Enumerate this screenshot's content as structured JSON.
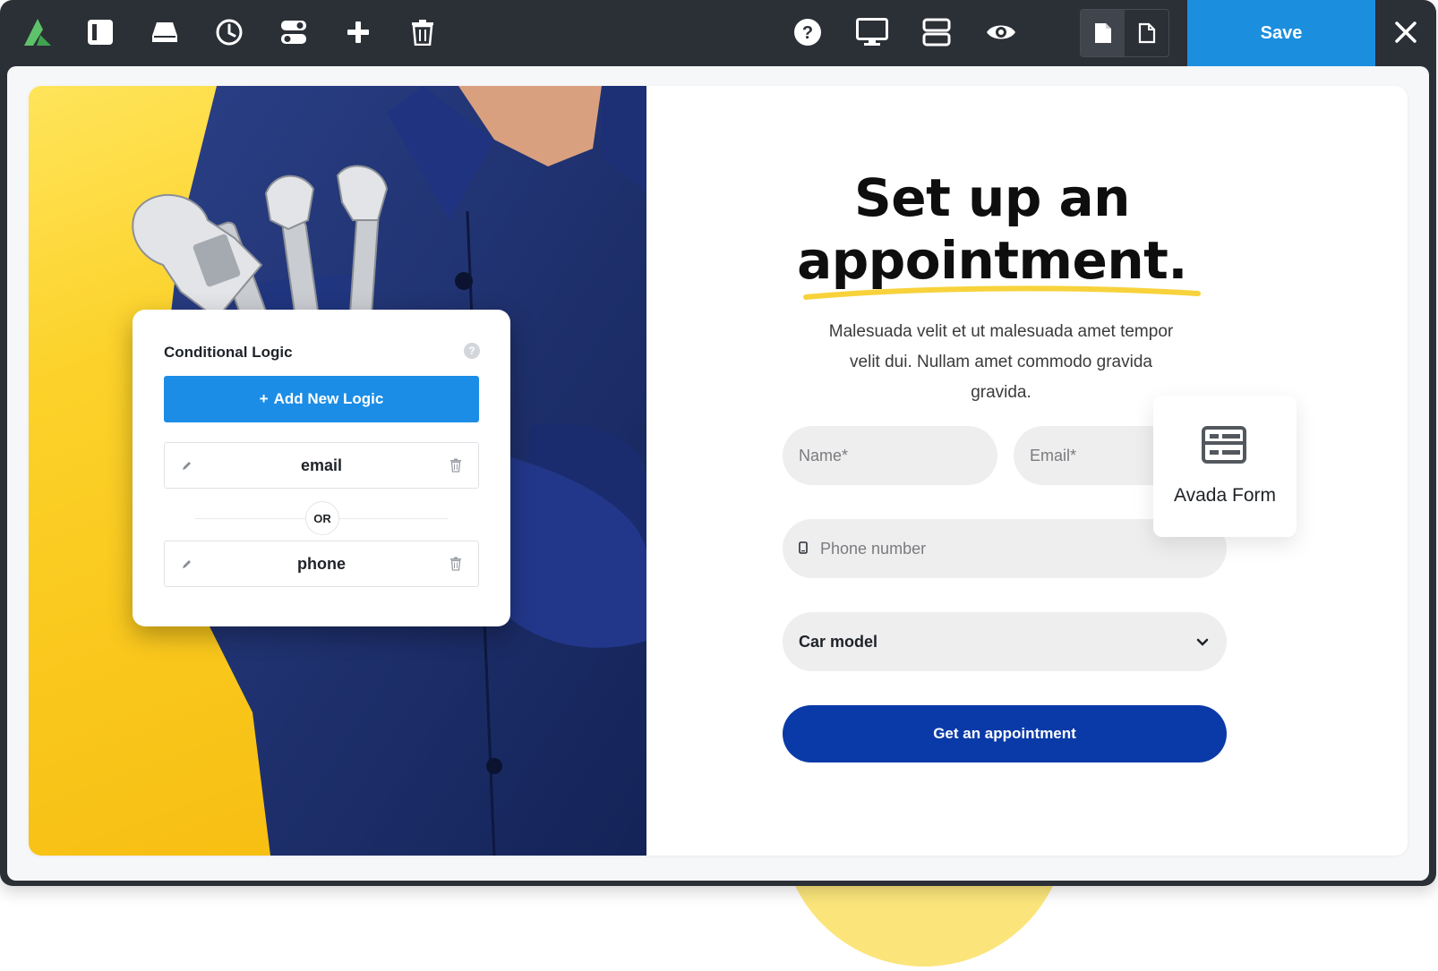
{
  "toolbar": {
    "left_icons": [
      "avada-logo-icon",
      "sidebar-panel-icon",
      "library-icon",
      "history-icon",
      "toggle-icon",
      "add-icon",
      "trash-icon"
    ],
    "right_icons": [
      "help-icon",
      "desktop-preview-icon",
      "layout-icon",
      "preview-eye-icon"
    ],
    "toggle": [
      "page-icon",
      "page-outline-icon"
    ],
    "save_label": "Save",
    "close_icon": "close-icon",
    "save_color": "#1c8ede",
    "bar_color": "#2b2f36"
  },
  "logic_panel": {
    "title": "Conditional Logic",
    "help": "?",
    "add_label": "Add New Logic",
    "add_icon": "+",
    "rows": [
      {
        "label": "email"
      },
      {
        "label": "phone"
      }
    ],
    "operator": "OR",
    "accent": "#1b8de6"
  },
  "form": {
    "headline_line1": "Set up an",
    "headline_line2": "appointment.",
    "description": "Malesuada velit et ut malesuada amet tempor velit dui. Nullam amet commodo gravida gravida.",
    "name_placeholder": "Name*",
    "email_placeholder": "Email*",
    "phone_placeholder": "Phone number",
    "car_label": "Car model",
    "cta_label": "Get an appointment",
    "cta_color": "#0a3aa7",
    "underline_color": "#f7d23b"
  },
  "element_card": {
    "label": "Avada Form",
    "icon": "form-icon"
  }
}
